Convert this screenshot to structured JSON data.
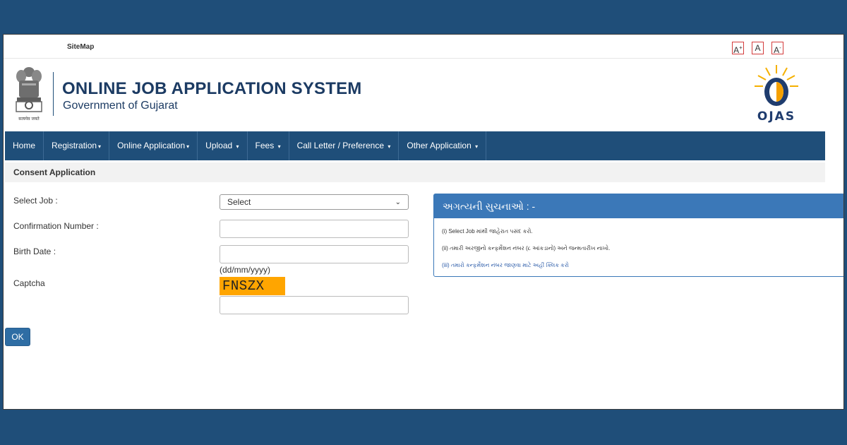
{
  "topbar": {
    "sitemap_label": "SiteMap",
    "font_buttons": [
      {
        "label": "A",
        "suffix": "+"
      },
      {
        "label": "A",
        "suffix": ""
      },
      {
        "label": "A",
        "suffix": "-"
      }
    ]
  },
  "header": {
    "emblem_caption": "सत्यमेव जयते",
    "title": "ONLINE JOB APPLICATION SYSTEM",
    "subtitle": "Government of Gujarat",
    "logo_text": "OJAS"
  },
  "nav": {
    "items": [
      {
        "label": "Home",
        "dropdown": false
      },
      {
        "label": "Registration",
        "dropdown": true
      },
      {
        "label": "Online Application",
        "dropdown": true
      },
      {
        "label": "Upload",
        "dropdown": true
      },
      {
        "label": "Fees",
        "dropdown": true
      },
      {
        "label": "Call Letter / Preference",
        "dropdown": true
      },
      {
        "label": "Other Application",
        "dropdown": true
      }
    ]
  },
  "breadcrumb": {
    "title": "Consent Application"
  },
  "form": {
    "select_job_label": "Select Job :",
    "select_job_value": "Select",
    "confirmation_label": "Confirmation Number :",
    "confirmation_value": "",
    "birth_date_label": "Birth Date :",
    "birth_date_value": "",
    "birth_date_hint": "(dd/mm/yyyy)",
    "captcha_label": "Captcha",
    "captcha_code": "FNSZX",
    "captcha_value": "",
    "submit_label": "OK"
  },
  "instructions": {
    "title": "અગત્યની સુચનાઓ : -",
    "items": [
      "(i) Select Job માંથી જાહેરાત પસંદ કરો.",
      "(ii) તમારી અરજીનો કન્ફર્મેશન નંબર (૮ આંકડાનો) અને જન્મતારીખ નાખો.",
      "(iii) તમારો કન્ફર્મેશન નંબર જાણવા માટે અહીં ક્લિક કરો"
    ]
  },
  "colors": {
    "page_bg": "#1f4e79",
    "nav_bg": "#1f4e79",
    "panel_header": "#3b78b8",
    "captcha_bg": "#ffa500",
    "button_bg": "#2e6da4",
    "title_color": "#1c3b63"
  }
}
